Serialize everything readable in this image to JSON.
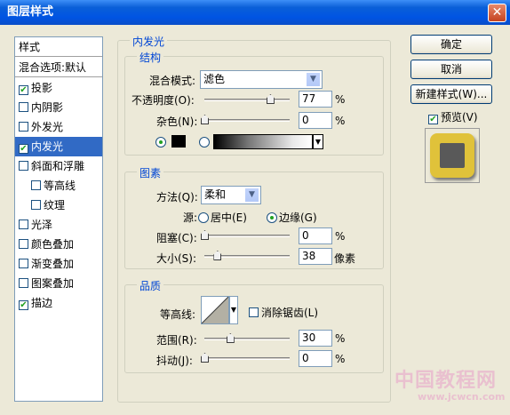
{
  "window": {
    "title": "图层样式",
    "close_glyph": "✕"
  },
  "sidebar": {
    "header": "样式",
    "blend_options": "混合选项:默认",
    "items": [
      {
        "label": "投影",
        "checked": true,
        "indent": false
      },
      {
        "label": "内阴影",
        "checked": false,
        "indent": false
      },
      {
        "label": "外发光",
        "checked": false,
        "indent": false
      },
      {
        "label": "内发光",
        "checked": true,
        "indent": false,
        "selected": true
      },
      {
        "label": "斜面和浮雕",
        "checked": false,
        "indent": false
      },
      {
        "label": "等高线",
        "checked": false,
        "indent": true
      },
      {
        "label": "纹理",
        "checked": false,
        "indent": true
      },
      {
        "label": "光泽",
        "checked": false,
        "indent": false
      },
      {
        "label": "颜色叠加",
        "checked": false,
        "indent": false
      },
      {
        "label": "渐变叠加",
        "checked": false,
        "indent": false
      },
      {
        "label": "图案叠加",
        "checked": false,
        "indent": false
      },
      {
        "label": "描边",
        "checked": true,
        "indent": false
      }
    ]
  },
  "panel": {
    "title": "内发光",
    "structure": {
      "label": "结构",
      "blend_mode_label": "混合模式:",
      "blend_mode_value": "滤色",
      "opacity_label": "不透明度(O):",
      "opacity_value": "77",
      "noise_label": "杂色(N):",
      "noise_value": "0",
      "percent": "%",
      "opacity_level": 0.77,
      "noise_level": 0.0
    },
    "elements": {
      "label": "图素",
      "technique_label": "方法(Q):",
      "technique_value": "柔和",
      "source_label": "源:",
      "source_center": "居中(E)",
      "source_edge": "边缘(G)",
      "choke_label": "阻塞(C):",
      "choke_value": "0",
      "size_label": "大小(S):",
      "size_value": "38",
      "size_unit": "像素",
      "choke_level": 0.0,
      "size_level": 0.15
    },
    "quality": {
      "label": "品质",
      "contour_label": "等高线:",
      "antialias_label": "消除锯齿(L)",
      "range_label": "范围(R):",
      "range_value": "30",
      "jitter_label": "抖动(J):",
      "jitter_value": "0",
      "range_level": 0.3,
      "jitter_level": 0.0
    }
  },
  "buttons": {
    "ok": "确定",
    "cancel": "取消",
    "new_style": "新建样式(W)...",
    "preview": "预览(V)"
  },
  "watermark": {
    "line1": "中国教程网",
    "line2": "www.jcwcn.com"
  },
  "colors": {
    "glow_color": "#000000",
    "preview_outer": "#e0c23a",
    "preview_inner": "#595959",
    "accent": "#316ac5"
  }
}
